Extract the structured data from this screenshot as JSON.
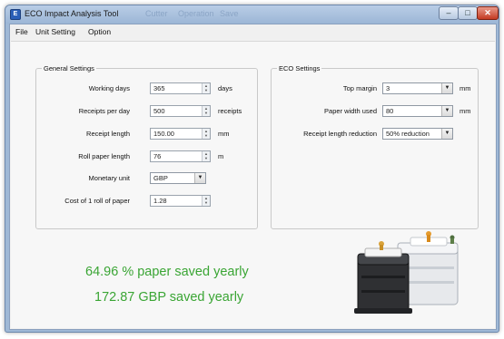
{
  "window": {
    "title": "ECO Impact Analysis Tool",
    "title_ghosts": [
      "Cutter",
      "Operation",
      "Save"
    ],
    "controls": {
      "minimize": "–",
      "maximize": "□",
      "close": "✕"
    }
  },
  "menu": {
    "items": [
      "File",
      "Unit Setting",
      "Option"
    ]
  },
  "general": {
    "title": "General Settings",
    "working_days": {
      "label": "Working days",
      "value": "365",
      "unit": "days"
    },
    "receipts_per_day": {
      "label": "Receipts per day",
      "value": "500",
      "unit": "receipts"
    },
    "receipt_length": {
      "label": "Receipt length",
      "value": "150.00",
      "unit": "mm"
    },
    "roll_paper_length": {
      "label": "Roll paper length",
      "value": "76",
      "unit": "m"
    },
    "monetary_unit": {
      "label": "Monetary unit",
      "value": "GBP"
    },
    "cost_per_roll": {
      "label": "Cost of 1 roll of paper",
      "value": "1.28"
    }
  },
  "eco": {
    "title": "ECO Settings",
    "top_margin": {
      "label": "Top margin",
      "value": "3",
      "unit": "mm"
    },
    "paper_width": {
      "label": "Paper width used",
      "value": "80",
      "unit": "mm"
    },
    "length_reduction": {
      "label": "Receipt length reduction",
      "value": "50% reduction"
    }
  },
  "results": {
    "paper_saved": "64.96 % paper saved yearly",
    "money_saved": "172.87 GBP saved yearly"
  },
  "icons": {
    "spin_up": "▲",
    "spin_down": "▼",
    "dropdown": "▼",
    "app_icon": "E"
  },
  "colors": {
    "accent_green": "#3aa534",
    "titlebar": "#9fb8d6"
  }
}
